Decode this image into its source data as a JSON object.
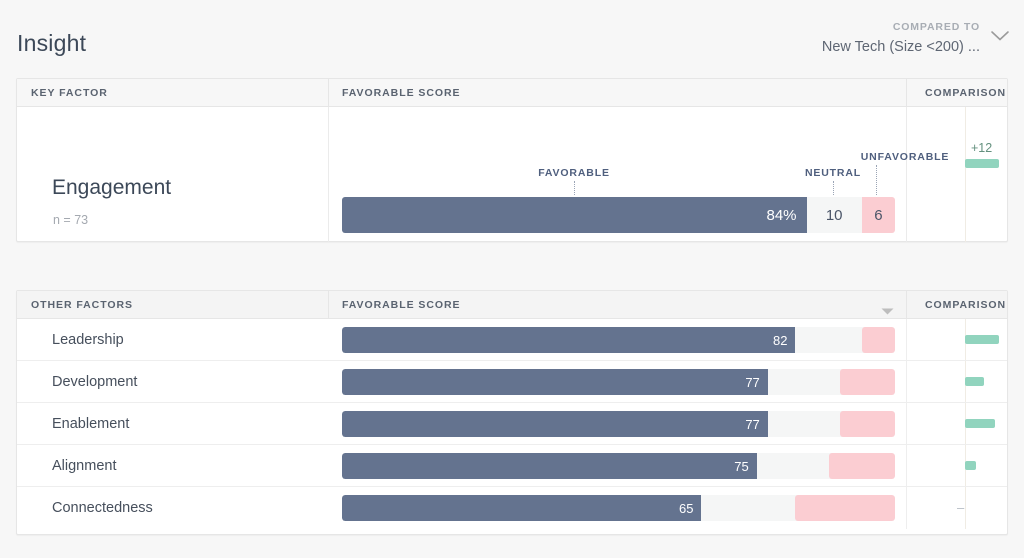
{
  "header": {
    "title": "Insight",
    "compared_to_label": "COMPARED TO",
    "compared_to_value": "New Tech (Size <200) ...",
    "chevron_icon": "chevron-down-icon"
  },
  "key_table": {
    "columns": {
      "factor": "KEY FACTOR",
      "favorable": "FAVORABLE SCORE",
      "comparison": "COMPARISON"
    },
    "row": {
      "name": "Engagement",
      "n": "n = 73",
      "favorable_label": "FAVORABLE",
      "neutral_label": "NEUTRAL",
      "unfavorable_label": "UNFAVORABLE",
      "favorable_value": "84%",
      "neutral_value": "10",
      "unfavorable_value": "6",
      "comparison_value": "+12"
    }
  },
  "other_table": {
    "columns": {
      "factor": "OTHER FACTORS",
      "favorable": "FAVORABLE SCORE",
      "comparison": "COMPARISON"
    },
    "sort_icon": "sort-descending-caret-icon",
    "rows": [
      {
        "name": "Leadership",
        "favorable": "82",
        "comparison": ""
      },
      {
        "name": "Development",
        "favorable": "77",
        "comparison": ""
      },
      {
        "name": "Enablement",
        "favorable": "77",
        "comparison": ""
      },
      {
        "name": "Alignment",
        "favorable": "75",
        "comparison": ""
      },
      {
        "name": "Connectedness",
        "favorable": "65",
        "comparison": "–"
      }
    ]
  },
  "colors": {
    "favorable": "#64738f",
    "neutral": "#f5f6f6",
    "unfavorable": "#fbcdd2",
    "comparison_positive": "#91d4be",
    "page_background": "#f7f7f7"
  },
  "chart_data": {
    "type": "bar",
    "title": "Insight — Favorable Score by factor",
    "xlabel": "",
    "ylabel": "",
    "xlim": [
      0,
      100
    ],
    "grid": false,
    "legend": [
      "FAVORABLE",
      "NEUTRAL",
      "UNFAVORABLE"
    ],
    "legend_position": "above-bar",
    "key_factor": {
      "category": "Engagement",
      "n": 73,
      "favorable": 84,
      "neutral": 10,
      "unfavorable": 6,
      "comparison": 12
    },
    "categories": [
      "Leadership",
      "Development",
      "Enablement",
      "Alignment",
      "Connectedness"
    ],
    "series": [
      {
        "name": "FAVORABLE",
        "values": [
          82,
          77,
          77,
          75,
          65
        ]
      },
      {
        "name": "UNFAVORABLE",
        "values": [
          6,
          10,
          10,
          12,
          18
        ]
      },
      {
        "name": "COMPARISON",
        "values": [
          9,
          5,
          8,
          3,
          0
        ]
      }
    ]
  }
}
